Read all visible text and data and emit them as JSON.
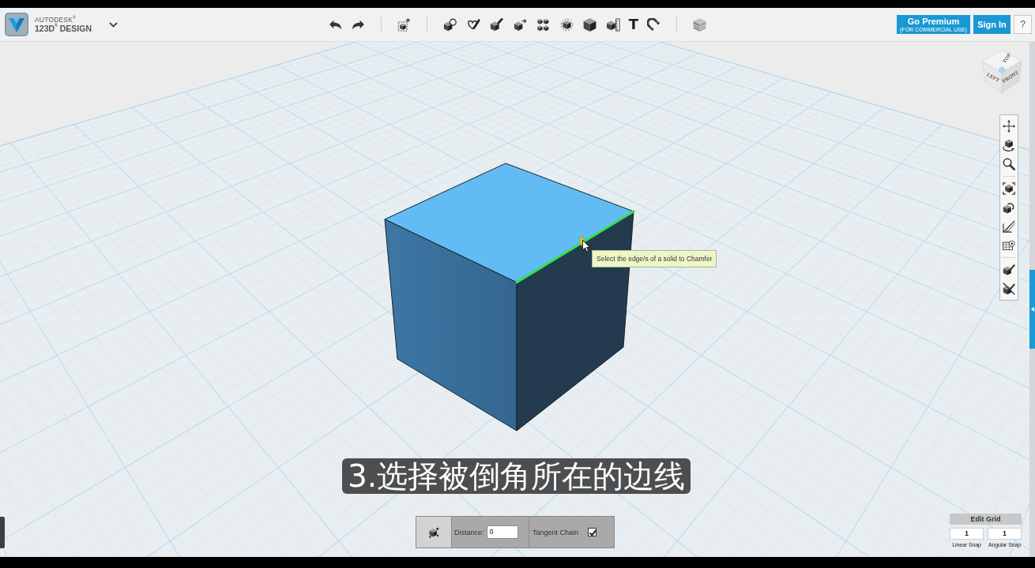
{
  "app": {
    "brand": "AUTODESK$^{®}$",
    "product": "123D$^{®}$ DESIGN"
  },
  "toolbar": {
    "text_tool": "T"
  },
  "account": {
    "premium_label": "Go Premium",
    "premium_note": "(FOR COMMERCIAL USE)",
    "sign_in": "Sign In",
    "help": "?"
  },
  "view_cube": {
    "top": "TOP",
    "left": "LEFT",
    "front": "FRONT"
  },
  "viewport": {
    "edge_highlighted": true,
    "tooltip": "Select the edge/s of a solid to Chamfer"
  },
  "chamfer_panel": {
    "distance_label": "Distance:",
    "distance": "0",
    "tangent_chain_label": "Tangent Chain",
    "tangent_chain_checked": true
  },
  "edit_grid": {
    "title": "Edit Grid",
    "fields": [
      {
        "label": "Linear Snap",
        "value": "1"
      },
      {
        "label": "Angular Snap",
        "value": "1"
      }
    ]
  },
  "subtitle": "3.选择被倒角所在的边线"
}
